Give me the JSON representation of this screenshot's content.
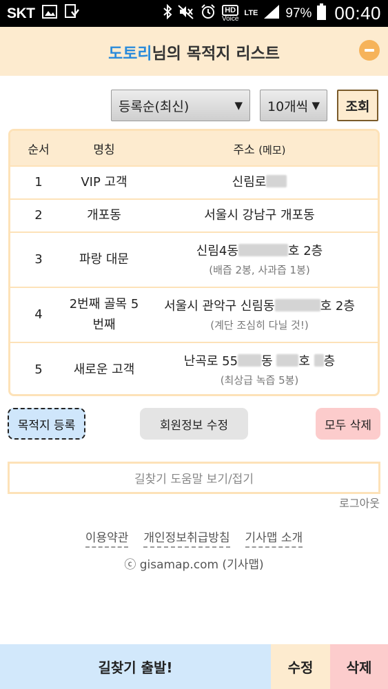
{
  "status_bar": {
    "carrier": "SKT",
    "hd_label": "HD",
    "voice_label": "Voice",
    "lte_label": "LTE",
    "battery": "97%",
    "time": "00:40",
    "icons": [
      "image-icon",
      "download-icon",
      "bluetooth-icon",
      "mute-icon",
      "alarm-icon",
      "signal-icon",
      "battery-icon"
    ]
  },
  "header": {
    "user_name": "도토리",
    "title_suffix": "님의 목적지 리스트"
  },
  "controls": {
    "sort_selected": "등록순(최신)",
    "count_selected": "10개씩",
    "search_label": "조회"
  },
  "table": {
    "headers": {
      "no": "순서",
      "name": "명칭",
      "address": "주소",
      "memo": "(메모)"
    },
    "rows": [
      {
        "no": "1",
        "name": "VIP 고객",
        "address_parts": [
          "신림로",
          ""
        ],
        "memo": ""
      },
      {
        "no": "2",
        "name": "개포동",
        "address_parts": [
          "서울시 강남구 개포동"
        ],
        "memo": ""
      },
      {
        "no": "3",
        "name": "파랑 대문",
        "address_parts": [
          "신림4동",
          "호 2층"
        ],
        "memo": "(배즙 2봉, 사과즙 1봉)"
      },
      {
        "no": "4",
        "name": "2번째 골목 5번째",
        "address_parts": [
          "서울시 관악구 신림동",
          "호 2층"
        ],
        "memo": "(계단 조심히 다닐 것!)"
      },
      {
        "no": "5",
        "name": "새로운 고객",
        "address_parts": [
          "난곡로 55",
          "동",
          "호",
          "층"
        ],
        "memo": "(최상급 녹즙 5봉)"
      }
    ]
  },
  "actions": {
    "register": "목적지 등록",
    "member_edit": "회원정보 수정",
    "delete_all": "모두 삭제"
  },
  "help": {
    "toggle_label": "길찾기 도움말 보기/접기",
    "logout": "로그아웃"
  },
  "footer": {
    "links": [
      "이용약관",
      "개인정보취급방침",
      "기사맵 소개"
    ],
    "copyright": "ⓒ gisamap.com (기사맵)"
  },
  "bottom_bar": {
    "go": "길찾기 출발!",
    "edit": "수정",
    "delete": "삭제"
  },
  "colors": {
    "header_bg": "#fdebcf",
    "user_name": "#2a8bdb",
    "collapse_button": "#f6b35a",
    "register_bg": "#cfe6fb",
    "delete_bg": "#fccccc"
  }
}
